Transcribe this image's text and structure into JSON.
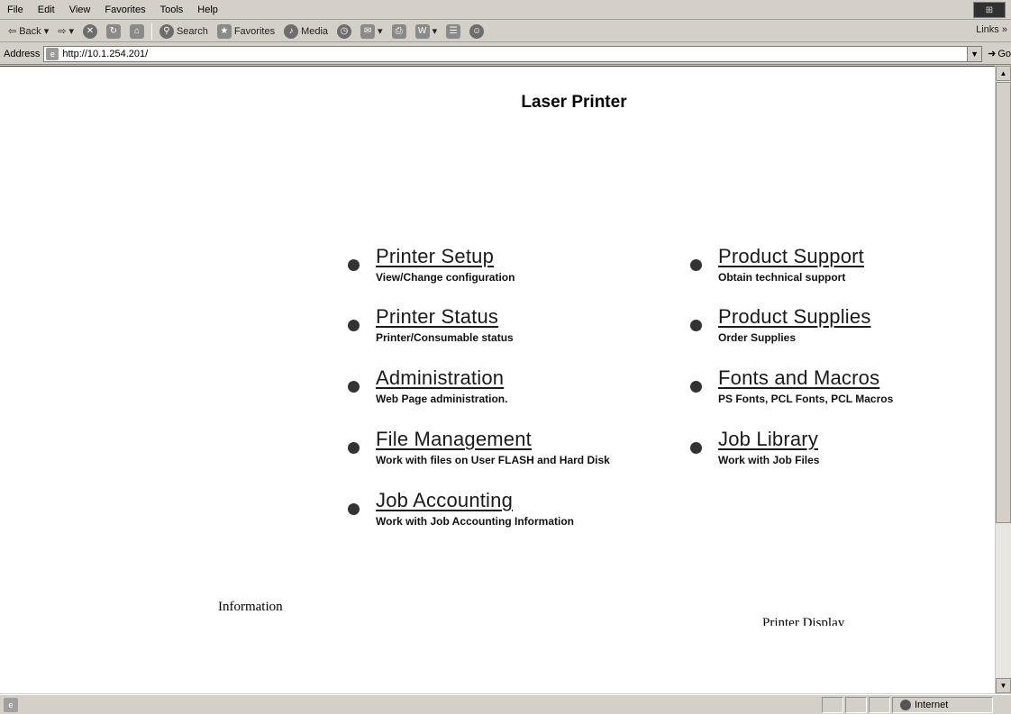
{
  "menu": {
    "items": [
      "File",
      "Edit",
      "View",
      "Favorites",
      "Tools",
      "Help"
    ]
  },
  "toolbar": {
    "back_label": "Back",
    "search_label": "Search",
    "favorites_label": "Favorites",
    "media_label": "Media",
    "links_label": "Links"
  },
  "address": {
    "label": "Address",
    "url": "http://10.1.254.201/",
    "go_label": "Go"
  },
  "page": {
    "title": "Laser Printer",
    "nav_left": [
      {
        "label": "Printer Setup",
        "desc": "View/Change configuration"
      },
      {
        "label": "Printer Status",
        "desc": "Printer/Consumable status"
      },
      {
        "label": "Administration",
        "desc": "Web Page administration."
      },
      {
        "label": "File Management",
        "desc": "Work with files on User FLASH and Hard Disk"
      },
      {
        "label": "Job Accounting",
        "desc": "Work with Job Accounting Information"
      }
    ],
    "nav_right": [
      {
        "label": "Product Support",
        "desc": "Obtain technical support"
      },
      {
        "label": "Product Supplies",
        "desc": "Order Supplies"
      },
      {
        "label": "Fonts and Macros",
        "desc": "PS Fonts, PCL Fonts, PCL Macros"
      },
      {
        "label": "Job Library",
        "desc": "Work with Job Files"
      }
    ],
    "information_heading": "Information",
    "printer_display_heading": "Printer Display"
  },
  "status": {
    "zone": "Internet"
  },
  "colors": {
    "chrome": "#d4d0c8",
    "link": "#1a1a1a",
    "bullet": "#333333"
  }
}
